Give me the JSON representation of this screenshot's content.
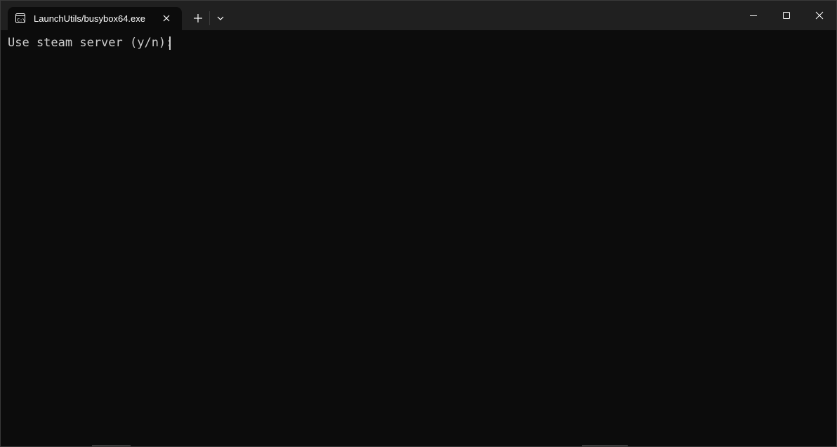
{
  "tab": {
    "title": "LaunchUtils/busybox64.exe",
    "icon": "terminal-icon"
  },
  "titlebar": {
    "new_tab_icon": "plus-icon",
    "dropdown_icon": "chevron-down-icon",
    "minimize_icon": "minimize-icon",
    "maximize_icon": "maximize-icon",
    "close_icon": "close-icon"
  },
  "terminal": {
    "prompt_line": "Use steam server (y/n): "
  },
  "colors": {
    "background": "#0c0c0c",
    "titlebar": "#202020",
    "foreground": "#cccccc"
  }
}
